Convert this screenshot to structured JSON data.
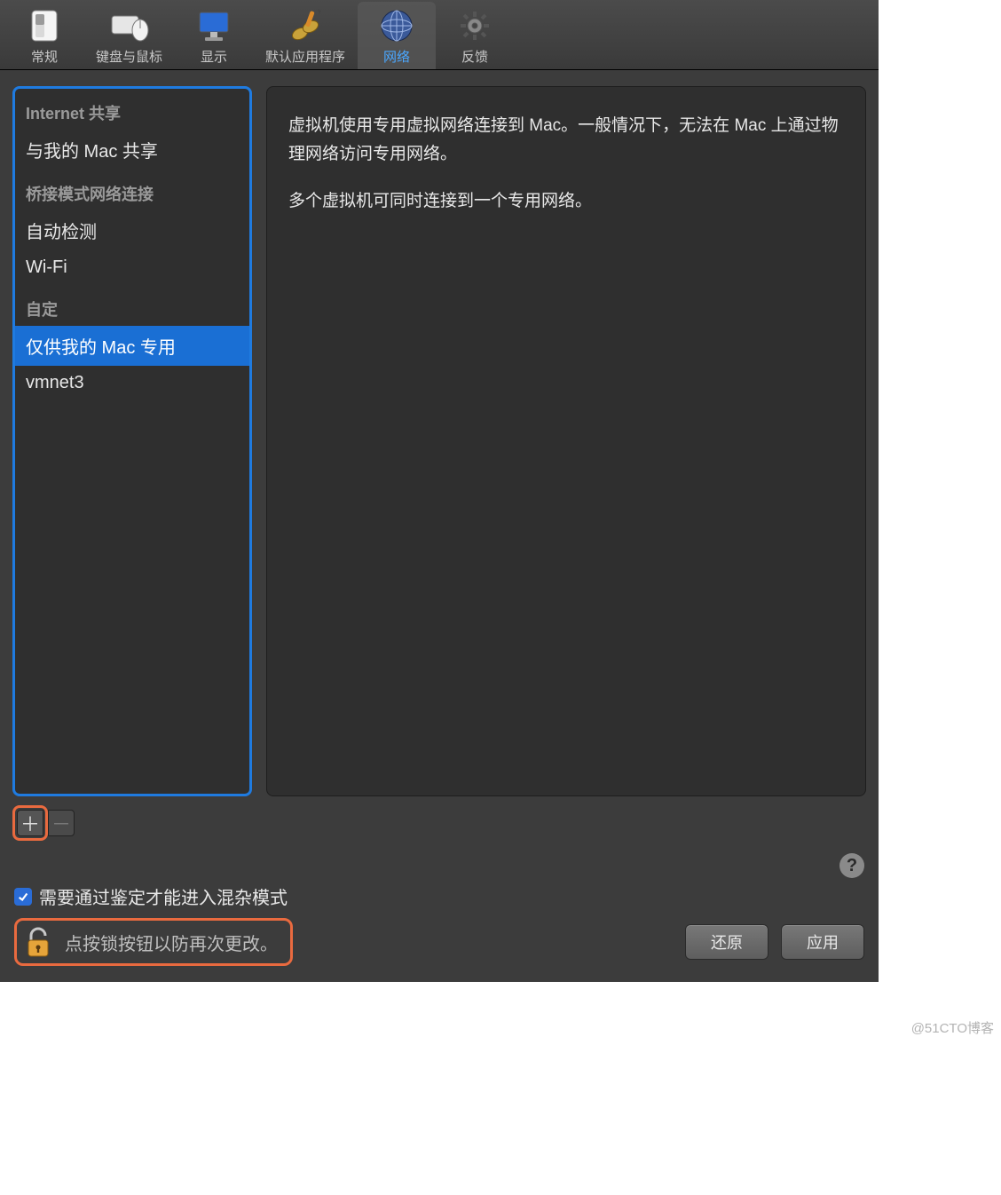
{
  "toolbar": {
    "tabs": [
      {
        "id": "general",
        "label": "常规"
      },
      {
        "id": "keyboard",
        "label": "键盘与鼠标"
      },
      {
        "id": "display",
        "label": "显示"
      },
      {
        "id": "default-apps",
        "label": "默认应用程序"
      },
      {
        "id": "network",
        "label": "网络",
        "active": true
      },
      {
        "id": "feedback",
        "label": "反馈"
      }
    ]
  },
  "sidebar": {
    "section_internet_sharing": "Internet 共享",
    "item_share_with_mac": "与我的 Mac 共享",
    "section_bridged": "桥接模式网络连接",
    "item_autodetect": "自动检测",
    "item_wifi": "Wi-Fi",
    "section_custom": "自定",
    "item_host_only": "仅供我的 Mac 专用",
    "item_vmnet3": "vmnet3"
  },
  "detail": {
    "para1": "虚拟机使用专用虚拟网络连接到 Mac。一般情况下，无法在 Mac 上通过物理网络访问专用网络。",
    "para2": "多个虚拟机可同时连接到一个专用网络。"
  },
  "footer": {
    "help": "?",
    "checkbox_label": "需要通过鉴定才能进入混杂模式",
    "lock_text": "点按锁按钮以防再次更改。",
    "revert": "还原",
    "apply": "应用",
    "add": "＋",
    "remove": "－"
  },
  "watermark": "@51CTO博客"
}
